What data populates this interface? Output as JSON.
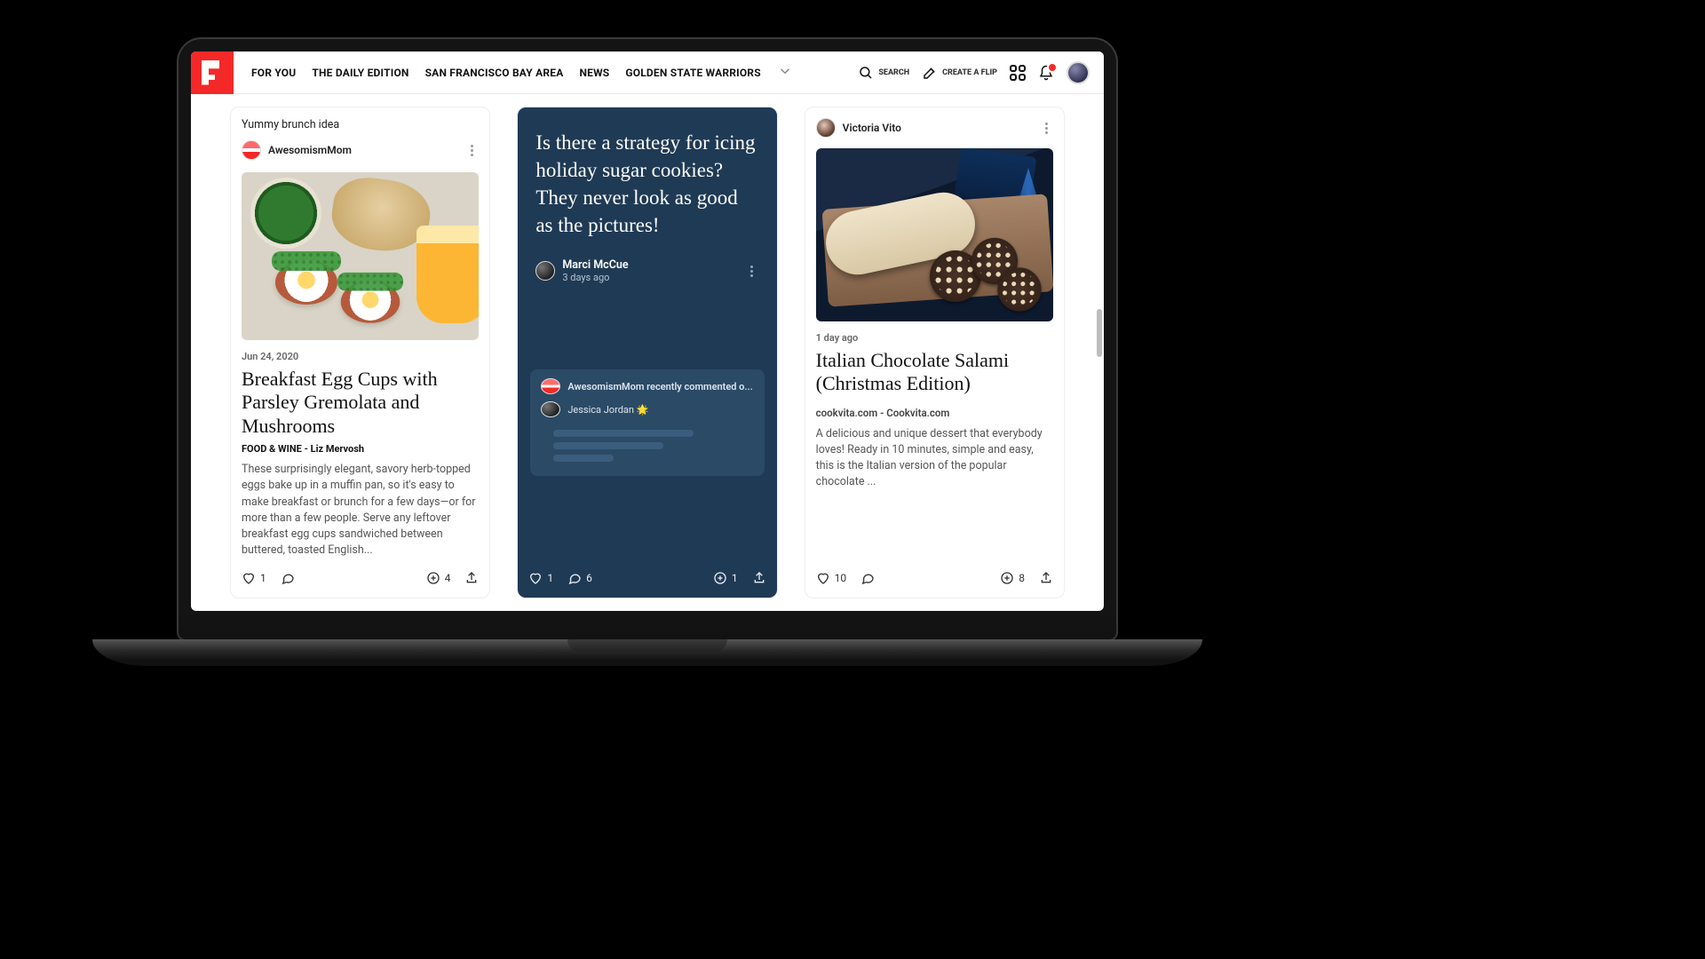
{
  "nav": {
    "items": [
      "FOR YOU",
      "THE DAILY EDITION",
      "SAN FRANCISCO BAY AREA",
      "NEWS",
      "GOLDEN STATE WARRIORS"
    ]
  },
  "topbar": {
    "search_label": "SEARCH",
    "create_label": "CREATE A FLIP"
  },
  "cards": {
    "c1": {
      "caption": "Yummy brunch idea",
      "author": "AwesomismMom",
      "date": "Jun 24, 2020",
      "title": "Breakfast Egg Cups with Parsley Gremolata and Mushrooms",
      "byline": "FOOD & WINE - Liz Mervosh",
      "excerpt": "These surprisingly elegant, savory herb-topped eggs bake up in a muffin pan, so it's easy to make breakfast or brunch for a few days—or for more than a few people. Serve any leftover breakfast egg cups sandwiched between buttered, toasted English...",
      "likes": "1",
      "flips": "4"
    },
    "c2": {
      "question": "Is there a strategy for icing holiday sugar cookies? They never look as good as the pictures!",
      "author": "Marci McCue",
      "time": "3 days ago",
      "comment_lead": "AwesomismMom recently commented o...",
      "comment_user": "Jessica Jordan 🌟",
      "likes": "1",
      "comments": "6",
      "flips": "1"
    },
    "c3": {
      "author": "Victoria Vito",
      "time": "1 day ago",
      "title": "Italian Chocolate Salami (Christmas Edition)",
      "source": "cookvita.com - Cookvita.com",
      "excerpt": "A delicious and unique dessert that everybody loves! Ready in 10 minutes, simple and easy, this is the Italian version of the popular chocolate ...",
      "likes": "10",
      "flips": "8"
    }
  }
}
